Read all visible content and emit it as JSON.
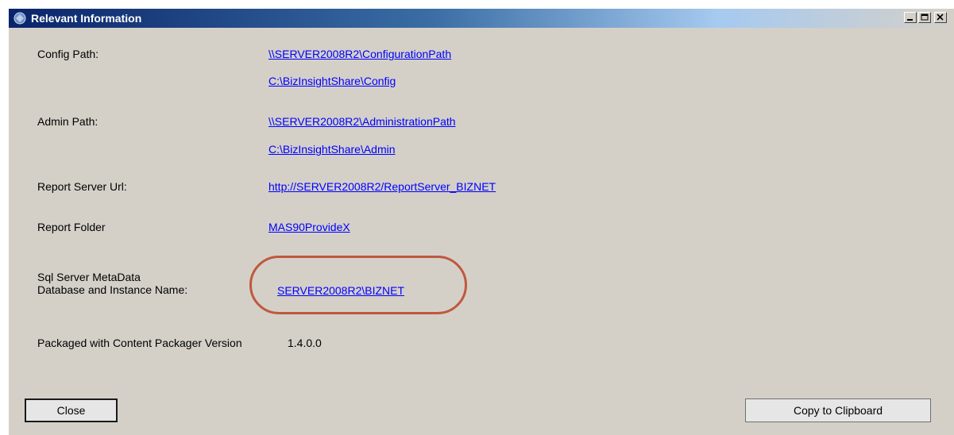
{
  "window": {
    "title": "Relevant Information",
    "icon": "app-icon"
  },
  "controls": {
    "minimize_icon": "minimize-icon",
    "maximize_icon": "maximize-icon",
    "close_icon": "close-icon"
  },
  "fields": {
    "config_label": "Config Path:",
    "config_unc": "\\\\SERVER2008R2\\ConfigurationPath",
    "config_local": "C:\\BizInsightShare\\Config",
    "admin_label": "Admin Path:",
    "admin_unc": "\\\\SERVER2008R2\\AdministrationPath",
    "admin_local": "C:\\BizInsightShare\\Admin",
    "report_url_label": "Report Server Url:",
    "report_url": "http://SERVER2008R2/ReportServer_BIZNET",
    "report_folder_label": "Report Folder",
    "report_folder": "MAS90ProvideX",
    "sql_label_line1": "Sql Server MetaData",
    "sql_label_line2": "Database and Instance Name:",
    "sql_instance": "SERVER2008R2\\BIZNET",
    "packager_label": "Packaged with Content Packager Version",
    "packager_version": "1.4.0.0"
  },
  "buttons": {
    "close_label": "Close",
    "copy_label": "Copy to Clipboard"
  },
  "colors": {
    "highlight": "#c0583e",
    "link": "#0000ff"
  }
}
